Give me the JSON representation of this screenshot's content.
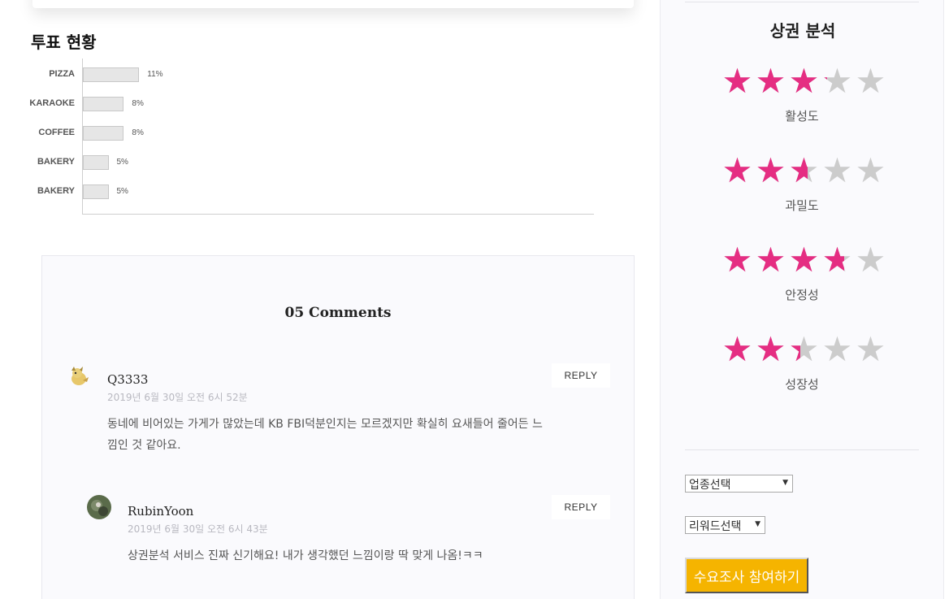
{
  "poll": {
    "title": "투표 현황",
    "chart_data": {
      "type": "bar",
      "orientation": "horizontal",
      "categories": [
        "PIZZA",
        "KARAOKE",
        "COFFEE",
        "BAKERY",
        "BAKERY"
      ],
      "values": [
        11,
        8,
        8,
        5,
        5
      ],
      "value_labels": [
        "11%",
        "8%",
        "8%",
        "5%",
        "5%"
      ],
      "xlim": [
        0,
        100
      ],
      "grid": false
    }
  },
  "comments": {
    "title": "05 Comments",
    "reply_label": "REPLY",
    "items": [
      {
        "author": "Q3333",
        "date": "2019년 6월 30일 오전 6시 52분",
        "body": "동네에 비어있는 가게가 많았는데 KB FBI덕분인지는 모르겠지만 확실히 요새들어 줄어든 느낌인 것 같아요."
      },
      {
        "author": "RubinYoon",
        "date": "2019년 6월 30일 오전 6시 43분",
        "body": "상권분석 서비스 진짜 신기해요! 내가 생각했던 느낌이랑 딱 맞게 나옴!ㅋㅋ"
      }
    ]
  },
  "sidebar": {
    "title": "상권 분석",
    "star_color": "#e52d82",
    "star_empty_color": "#cccccc",
    "ratings": [
      {
        "label": "활성도",
        "value": 3.2,
        "max": 5
      },
      {
        "label": "과밀도",
        "value": 2.6,
        "max": 5
      },
      {
        "label": "안정성",
        "value": 3.7,
        "max": 5
      },
      {
        "label": "성장성",
        "value": 2.4,
        "max": 5
      }
    ],
    "industry_select": "업종선택",
    "keyword_select": "리워드선택",
    "survey_button": "수요조사 참여하기",
    "survey_button_color": "#f5b400"
  }
}
